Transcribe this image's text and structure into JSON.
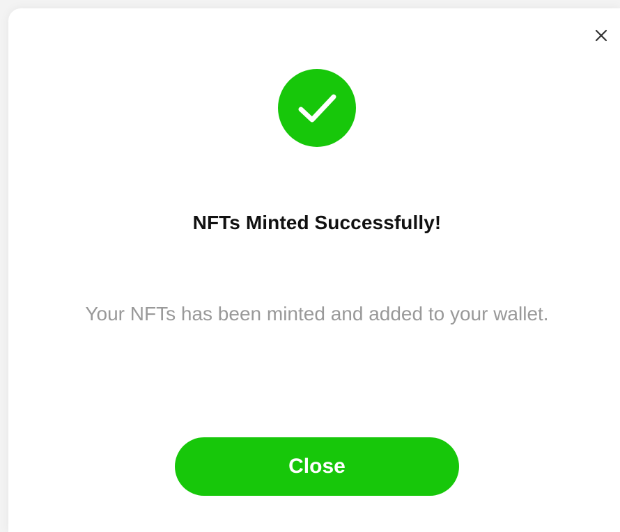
{
  "dialog": {
    "title": "NFTs Minted Successfully!",
    "message": "Your NFTs has been minted and added to your wallet.",
    "close_button_label": "Close",
    "icons": {
      "dismiss": "close-x-icon",
      "status": "checkmark-icon"
    }
  },
  "colors": {
    "accent": "#17c70a",
    "title": "#111111",
    "message": "#999999",
    "button_text": "#ffffff"
  }
}
